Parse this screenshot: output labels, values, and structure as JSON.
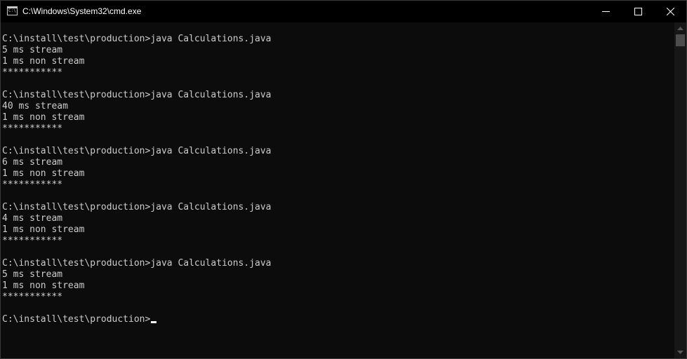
{
  "window": {
    "title": "C:\\Windows\\System32\\cmd.exe",
    "icon": "cmd-icon",
    "icon_glyph": "C:\\"
  },
  "controls": {
    "minimize_icon": "minimize-icon",
    "maximize_icon": "maximize-icon",
    "close_icon": "close-icon"
  },
  "terminal": {
    "lines": [
      "C:\\install\\test\\production>java Calculations.java",
      "5 ms stream",
      "1 ms non stream",
      "***********",
      "",
      "C:\\install\\test\\production>java Calculations.java",
      "40 ms stream",
      "1 ms non stream",
      "***********",
      "",
      "C:\\install\\test\\production>java Calculations.java",
      "6 ms stream",
      "1 ms non stream",
      "***********",
      "",
      "C:\\install\\test\\production>java Calculations.java",
      "4 ms stream",
      "1 ms non stream",
      "***********",
      "",
      "C:\\install\\test\\production>java Calculations.java",
      "5 ms stream",
      "1 ms non stream",
      "***********",
      ""
    ],
    "prompt": "C:\\install\\test\\production>"
  },
  "colors": {
    "background": "#0c0c0c",
    "text": "#cccccc",
    "titlebar": "#000000"
  }
}
